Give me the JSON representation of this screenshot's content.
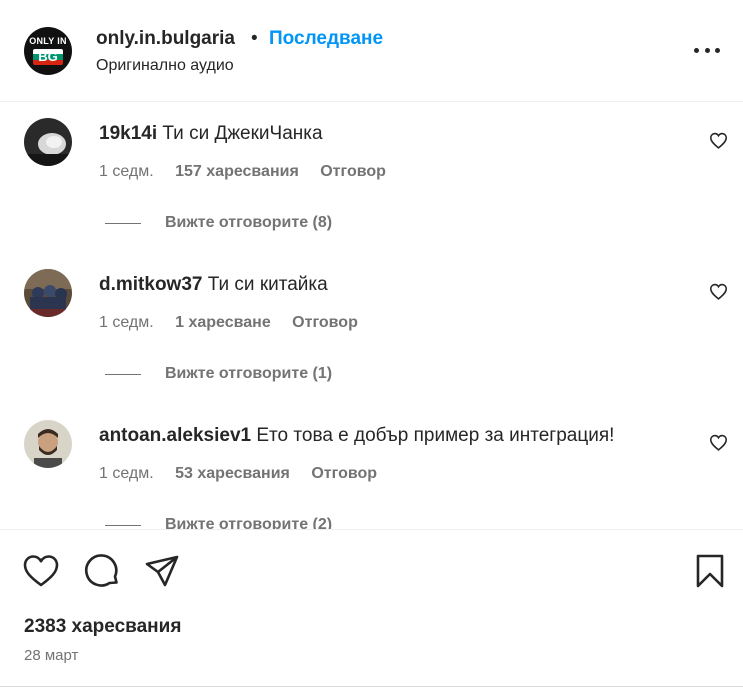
{
  "header": {
    "logo_top": "ONLY IN",
    "logo_bottom": "BG",
    "username": "only.in.bulgaria",
    "separator": "•",
    "follow_label": "Последване",
    "subtitle": "Оригинално аудио",
    "more_icon": "more-horizontal-icon"
  },
  "comments": [
    {
      "username": "19k14i",
      "text": "Ти си ДжекиЧанка",
      "time": "1 седм.",
      "likes": "157 харесвания",
      "reply": "Отговор",
      "view_replies": "Вижте отговорите (8)"
    },
    {
      "username": "d.mitkow37",
      "text": "Ти си китайка",
      "time": "1 седм.",
      "likes": "1 харесване",
      "reply": "Отговор",
      "view_replies": "Вижте отговорите (1)"
    },
    {
      "username": "antoan.aleksiev1",
      "text": "Ето това е добър пример за интеграция!",
      "time": "1 седм.",
      "likes": "53 харесвания",
      "reply": "Отговор",
      "view_replies": "Вижте отговорите (2)"
    }
  ],
  "actions": {
    "like_icon": "heart-icon",
    "comment_icon": "comment-icon",
    "share_icon": "share-icon",
    "save_icon": "bookmark-icon"
  },
  "post": {
    "likes_total": "2383 харесвания",
    "date": "28 март"
  },
  "colors": {
    "link": "#0095f6",
    "text": "#262626",
    "secondary": "#737373",
    "flag_white": "#ffffff",
    "flag_green": "#00966e",
    "flag_red": "#d62612"
  }
}
